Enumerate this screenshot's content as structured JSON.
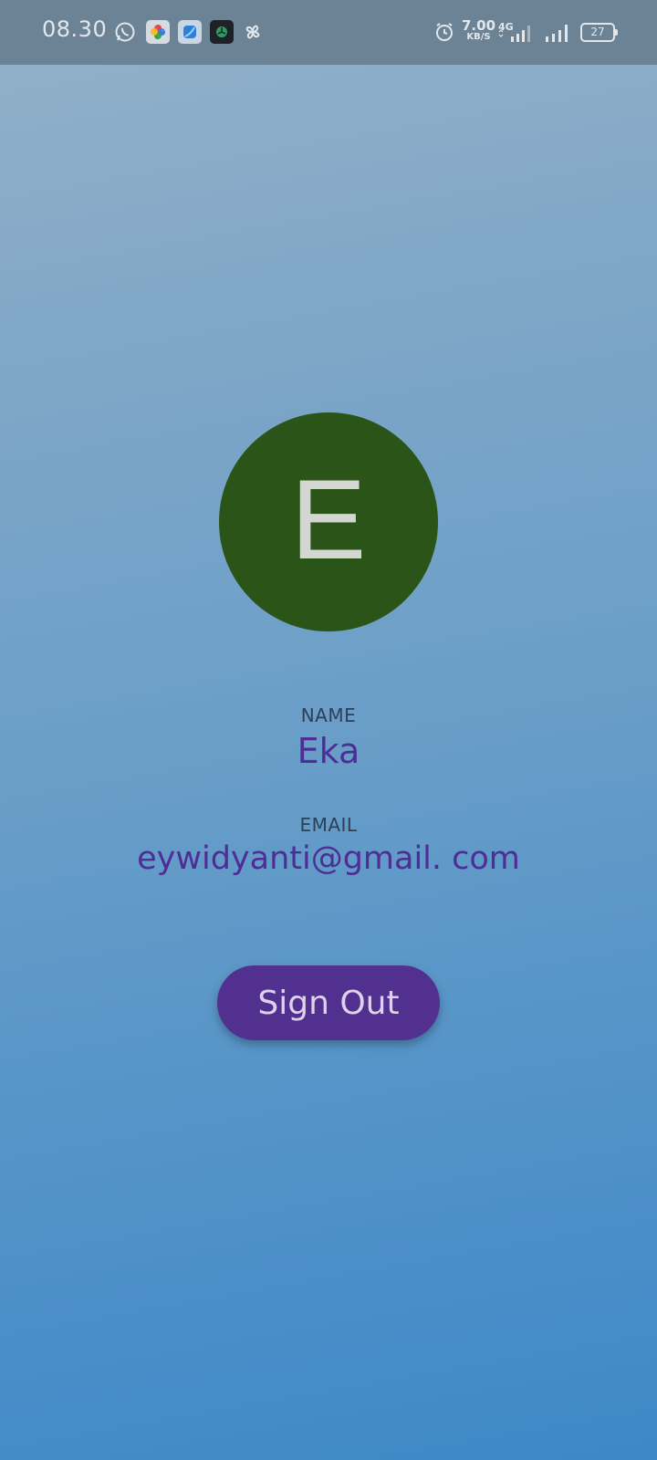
{
  "status_bar": {
    "time": "08.30",
    "notification_icons": [
      "whatsapp-icon",
      "google-photos-icon",
      "app-icon",
      "app-icon-dark",
      "pinwheel-icon"
    ],
    "alarm_icon": "alarm-icon",
    "network_speed": "7.00",
    "network_speed_unit": "KB/S",
    "network_type": "4G",
    "battery_level": "27"
  },
  "profile": {
    "avatar_letter": "E",
    "avatar_color": "#2b5419",
    "name_label": "NAME",
    "name_value": "Eka",
    "email_label": "EMAIL",
    "email_value": "eywidyanti@gmail. com"
  },
  "actions": {
    "sign_out_label": "Sign Out",
    "sign_out_color": "#51308f"
  }
}
